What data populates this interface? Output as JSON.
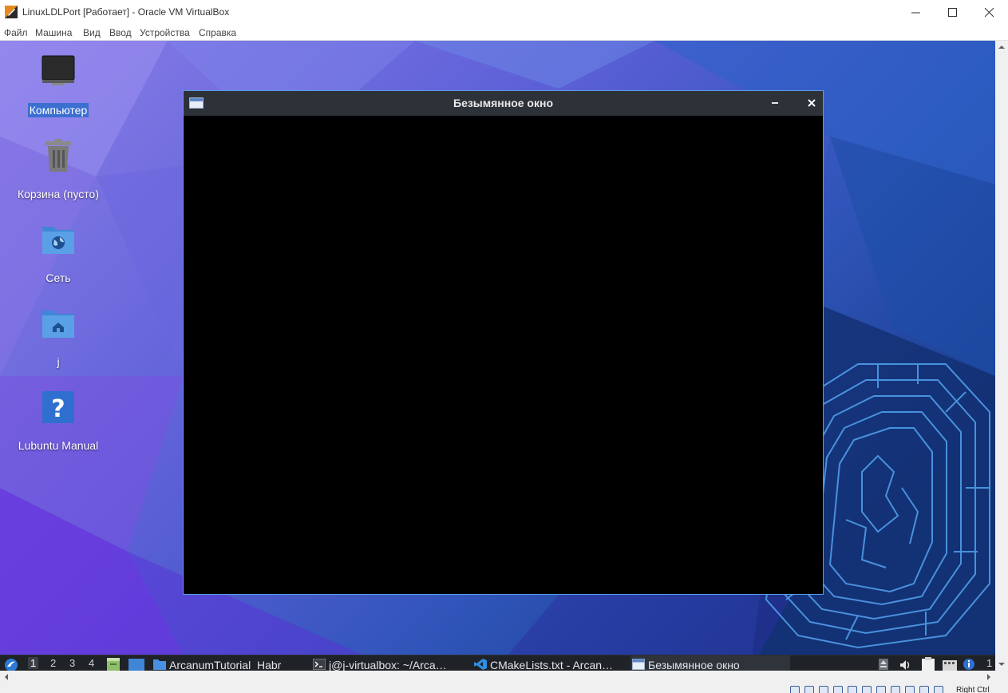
{
  "window": {
    "title": "LinuxLDLPort [Работает] - Oracle VM VirtualBox",
    "controls": [
      "minimize-icon",
      "maximize-icon",
      "close-icon"
    ]
  },
  "menu": [
    "Файл",
    "Машина",
    "Вид",
    "Ввод",
    "Устройства",
    "Справка"
  ],
  "desktop": {
    "icons": [
      {
        "label": "Компьютер",
        "icon": "monitor-icon",
        "selected": true
      },
      {
        "label": "Корзина (пусто)",
        "icon": "trash-icon",
        "selected": false
      },
      {
        "label": "Сеть",
        "icon": "network-folder-icon",
        "selected": false
      },
      {
        "label": "j",
        "icon": "home-folder-icon",
        "selected": false
      },
      {
        "label": "Lubuntu Manual",
        "icon": "help-icon",
        "selected": false
      }
    ]
  },
  "app_window": {
    "title": "Безымянное окно",
    "controls": [
      "minimize-icon",
      "close-icon"
    ]
  },
  "taskbar": {
    "workspaces": [
      "1",
      "2",
      "3",
      "4"
    ],
    "active_workspace": "1",
    "tasks": [
      {
        "label": "ArcanumTutorial_Habr",
        "icon": "folder-icon"
      },
      {
        "label": "j@j-virtualbox: ~/Arca…",
        "icon": "terminal-icon"
      },
      {
        "label": "CMakeLists.txt - Arcan…",
        "icon": "vscode-icon"
      },
      {
        "label": "Безымянное окно",
        "icon": "window-icon"
      }
    ],
    "tray_clock_partial": "1"
  },
  "statusbar": {
    "host_key": "Right Ctrl"
  },
  "colors": {
    "accent": "#5a9be6",
    "selection": "#3b6fd1",
    "titlebar_dark": "#2d3138",
    "taskbar": "#1f2226"
  }
}
